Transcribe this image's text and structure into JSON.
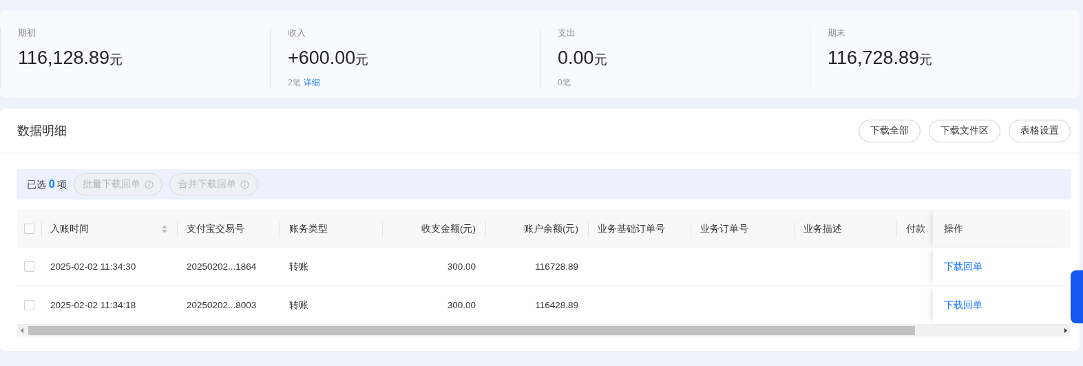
{
  "summary": [
    {
      "label": "期初",
      "amount": "116,128.89",
      "unit": "元"
    },
    {
      "label": "收入",
      "amount": "+600.00",
      "unit": "元",
      "count": "2笔",
      "link": "详细"
    },
    {
      "label": "支出",
      "amount": "0.00",
      "unit": "元",
      "count": "0笔"
    },
    {
      "label": "期末",
      "amount": "116,728.89",
      "unit": "元"
    }
  ],
  "detail": {
    "title": "数据明细",
    "buttons": [
      "下载全部",
      "下载文件区",
      "表格设置"
    ],
    "selection": {
      "prefix": "已选",
      "count": "0",
      "suffix": "项",
      "actions": [
        {
          "label": "批量下载回单",
          "disabled": true
        },
        {
          "label": "合并下载回单",
          "disabled": true
        }
      ]
    },
    "table": {
      "header_checked": false,
      "columns": [
        {
          "label": "入账时间",
          "kind": "text",
          "sortable": true
        },
        {
          "label": "支付宝交易号",
          "kind": "text",
          "sortable": false
        },
        {
          "label": "账务类型",
          "kind": "text",
          "sortable": false
        },
        {
          "label": "收支金额(元)",
          "kind": "amount",
          "sortable": false
        },
        {
          "label": "账户余额(元)",
          "kind": "amount",
          "sortable": false
        },
        {
          "label": "业务基础订单号",
          "kind": "text",
          "sortable": false
        },
        {
          "label": "业务订单号",
          "kind": "text",
          "sortable": false
        },
        {
          "label": "业务描述",
          "kind": "text",
          "sortable": false
        },
        {
          "label": "付款",
          "kind": "text",
          "sortable": false
        }
      ],
      "action_column": "操作",
      "rows": [
        {
          "checked": false,
          "cells": [
            "2025-02-02 11:34:30",
            "20250202...1864",
            "转账",
            "300.00",
            "116728.89"
          ],
          "action": "下载回单"
        },
        {
          "checked": false,
          "cells": [
            "2025-02-02 11:34:18",
            "20250202...8003",
            "转账",
            "300.00",
            "116428.89"
          ],
          "action": "下载回单"
        }
      ]
    }
  }
}
